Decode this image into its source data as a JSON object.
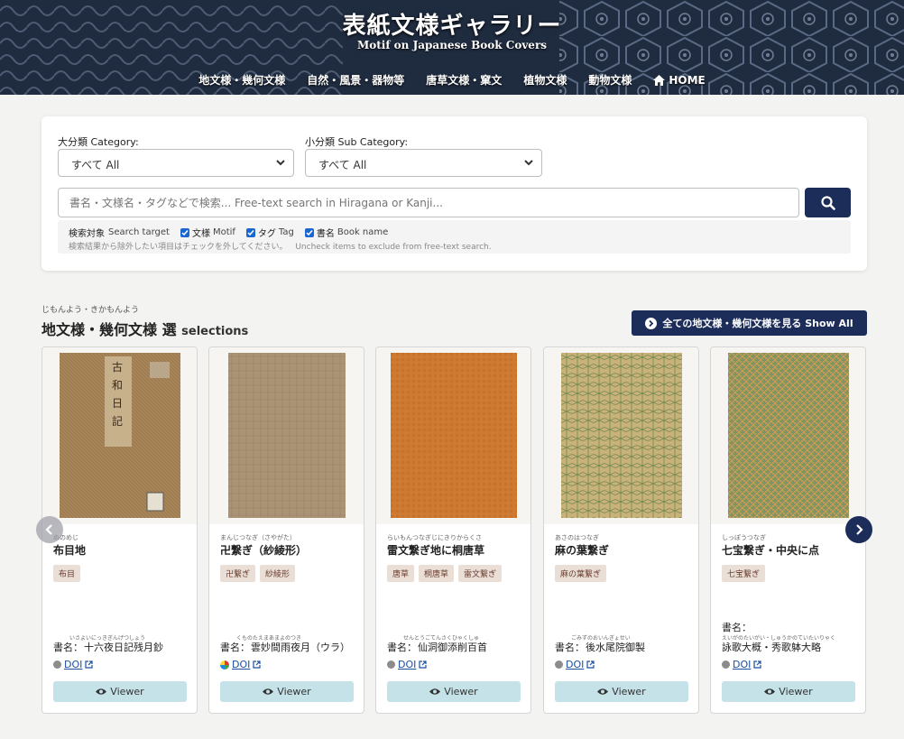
{
  "header": {
    "title": "表紙文様ギャラリー",
    "subtitle": "Motif on Japanese Book Covers",
    "nav": [
      {
        "label": "地文様・幾何文様"
      },
      {
        "label": "自然・風景・器物等"
      },
      {
        "label": "唐草文様・窠文"
      },
      {
        "label": "植物文様"
      },
      {
        "label": "動物文様"
      },
      {
        "label": "HOME",
        "icon": "home-icon"
      }
    ]
  },
  "search": {
    "category_label": "大分類 Category:",
    "category_value": "すべて All",
    "subcategory_label": "小分類 Sub Category:",
    "subcategory_value": "すべて All",
    "placeholder": "書名・文様名・タグなどで検索... Free-text search in Hiragana or Kanji...",
    "target_label": "検索対象",
    "target_label_en": "Search target",
    "options": [
      {
        "label": "文様",
        "en": "Motif",
        "checked": true
      },
      {
        "label": "タグ",
        "en": "Tag",
        "checked": true
      },
      {
        "label": "書名",
        "en": "Book name",
        "checked": true
      }
    ],
    "hint": "検索結果から除外したい項目はチェックを外してください。",
    "hint_en": "Uncheck items to exclude from free-text search."
  },
  "section": {
    "ruby": "じもんよう・きかもんよう",
    "title": "地文様・幾何文様 選",
    "title_en": "selections",
    "show_all": "全ての地文様・幾何文様を見る Show All"
  },
  "cards": [
    {
      "ruby": "ぬのめじ",
      "motif": "布目地",
      "tags": [
        "布目"
      ],
      "book_label": "書名：",
      "book_ruby": "いさよいにっきぎんげつしょう",
      "book": "十六夜日記残月鈔",
      "doi": "DOI",
      "viewer": "Viewer",
      "doi_color": "#8c8c8c"
    },
    {
      "ruby": "まんじつなぎ（さやがた）",
      "motif": "卍繋ぎ（紗綾形）",
      "tags": [
        "卍繋ぎ",
        "紗綾形"
      ],
      "book_label": "書名：",
      "book_ruby": "くものたえまあまよのつき",
      "book": "雲妙間雨夜月（ウラ）",
      "doi": "DOI",
      "viewer": "Viewer",
      "doi_color": "multicolor"
    },
    {
      "ruby": "らいもんつなぎじにきりからくさ",
      "motif": "雷文繋ぎ地に桐唐草",
      "tags": [
        "唐草",
        "桐唐草",
        "雷文繋ぎ"
      ],
      "book_label": "書名：",
      "book_ruby": "せんとうごてんさくひゃくしゅ",
      "book": "仙洞御添削百首",
      "doi": "DOI",
      "viewer": "Viewer",
      "doi_color": "#8c8c8c"
    },
    {
      "ruby": "あさのはつなぎ",
      "motif": "麻の葉繋ぎ",
      "tags": [
        "麻の葉繋ぎ"
      ],
      "book_label": "書名：",
      "book_ruby": "ごみずのおいんぎょせい",
      "book": "後水尾院御製",
      "doi": "DOI",
      "viewer": "Viewer",
      "doi_color": "#8c8c8c"
    },
    {
      "ruby": "しっぽうつなぎ",
      "motif": "七宝繋ぎ・中央に点",
      "tags": [
        "七宝繋ぎ"
      ],
      "book_label": "書名：",
      "book_ruby": "えいがのたいがい・しゅうかのていたいりゃく",
      "book": "詠歌大概・秀歌躰大略",
      "doi": "DOI",
      "viewer": "Viewer",
      "doi_color": "#8c8c8c"
    }
  ],
  "colors": {
    "navy": "#1c2d5a",
    "viewer_bg": "#c4e2e8",
    "tag_bg": "#eadfd6"
  }
}
